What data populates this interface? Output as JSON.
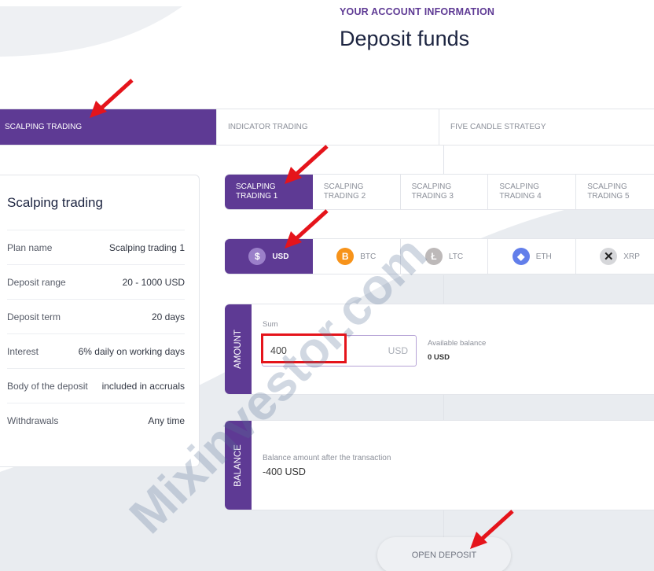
{
  "header": {
    "subtitle": "YOUR ACCOUNT INFORMATION",
    "title": "Deposit funds"
  },
  "strategy_tabs": [
    {
      "label": "SCALPING TRADING",
      "active": true
    },
    {
      "label": "INDICATOR TRADING",
      "active": false
    },
    {
      "label": "FIVE CANDLE STRATEGY",
      "active": false
    }
  ],
  "plan_card": {
    "title": "Scalping trading",
    "rows": [
      {
        "label": "Plan name",
        "value": "Scalping trading 1"
      },
      {
        "label": "Deposit range",
        "value": "20 - 1000 USD"
      },
      {
        "label": "Deposit term",
        "value": "20 days"
      },
      {
        "label": "Interest",
        "value": "6% daily on working days"
      },
      {
        "label": "Body of the deposit",
        "value": "included in accruals"
      },
      {
        "label": "Withdrawals",
        "value": "Any time"
      }
    ]
  },
  "plan_tabs": [
    {
      "line1": "SCALPING",
      "line2": "TRADING 1",
      "active": true
    },
    {
      "line1": "SCALPING",
      "line2": "TRADING 2",
      "active": false
    },
    {
      "line1": "SCALPING",
      "line2": "TRADING 3",
      "active": false
    },
    {
      "line1": "SCALPING",
      "line2": "TRADING 4",
      "active": false
    },
    {
      "line1": "SCALPING",
      "line2": "TRADING 5",
      "active": false
    }
  ],
  "currency_tabs": [
    {
      "label": "USD",
      "icon": "dollar-icon",
      "glyph": "$",
      "active": true
    },
    {
      "label": "BTC",
      "icon": "bitcoin-icon",
      "glyph": "B",
      "active": false
    },
    {
      "label": "LTC",
      "icon": "litecoin-icon",
      "glyph": "Ł",
      "active": false
    },
    {
      "label": "ETH",
      "icon": "ethereum-icon",
      "glyph": "◆",
      "active": false
    },
    {
      "label": "XRP",
      "icon": "ripple-icon",
      "glyph": "✕",
      "active": false
    }
  ],
  "amount": {
    "side_label": "AMOUNT",
    "sum_label": "Sum",
    "sum_value": "400",
    "sum_unit": "USD",
    "available_label": "Available balance",
    "available_value": "0  USD"
  },
  "balance": {
    "side_label": "BALANCE",
    "label": "Balance amount after the transaction",
    "value": "-400 USD"
  },
  "actions": {
    "open_deposit": "OPEN DEPOSIT"
  },
  "watermark": "Mixinvestor.com",
  "colors": {
    "accent": "#5e3a94",
    "annotation": "#e5141b",
    "background_shape": "#e9ecf0"
  }
}
